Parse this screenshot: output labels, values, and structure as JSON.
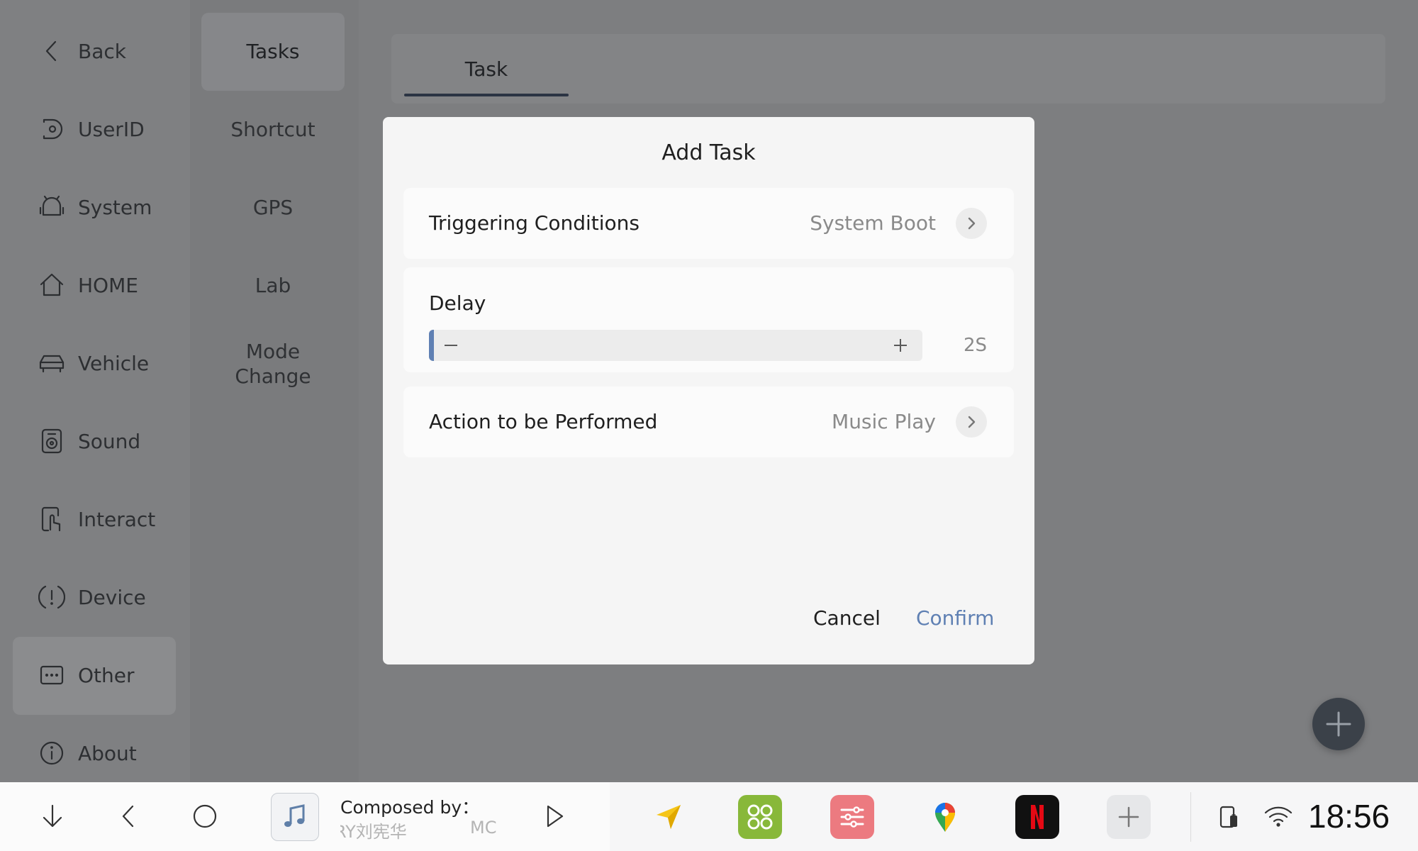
{
  "sidebar": {
    "items": [
      {
        "label": "Back",
        "icon": "chevron-left-icon"
      },
      {
        "label": "UserID",
        "icon": "user-id-icon"
      },
      {
        "label": "System",
        "icon": "android-icon"
      },
      {
        "label": "HOME",
        "icon": "home-icon"
      },
      {
        "label": "Vehicle",
        "icon": "car-icon"
      },
      {
        "label": "Sound",
        "icon": "speaker-icon"
      },
      {
        "label": "Interact",
        "icon": "touch-icon"
      },
      {
        "label": "Device",
        "icon": "alert-icon"
      },
      {
        "label": "Other",
        "icon": "more-icon",
        "active": true
      },
      {
        "label": "About",
        "icon": "info-icon"
      }
    ]
  },
  "subnav": {
    "items": [
      {
        "label": "Tasks",
        "active": true
      },
      {
        "label": "Shortcut"
      },
      {
        "label": "GPS"
      },
      {
        "label": "Lab"
      },
      {
        "label": "Mode Change"
      }
    ]
  },
  "main": {
    "tab_label": "Task"
  },
  "dialog": {
    "title": "Add Task",
    "trigger": {
      "label": "Triggering Conditions",
      "value": "System Boot"
    },
    "delay": {
      "label": "Delay",
      "value_text": "2S",
      "slider_fraction": 0.01
    },
    "action": {
      "label": "Action to be Performed",
      "value": "Music Play"
    },
    "cancel_label": "Cancel",
    "confirm_label": "Confirm"
  },
  "dock": {
    "composed_label": "Composed by：",
    "lyric_artist": "RY刘宪华",
    "lyric_extra": "MC",
    "apps": [
      "navigation-icon",
      "apps-grid-icon",
      "equalizer-icon",
      "maps-icon",
      "netflix-icon",
      "add-app-icon"
    ],
    "clock": "18:56"
  },
  "colors": {
    "accent": "#5f80b3",
    "overlay": "#7d7e80",
    "dialog_bg": "#f5f5f5"
  }
}
